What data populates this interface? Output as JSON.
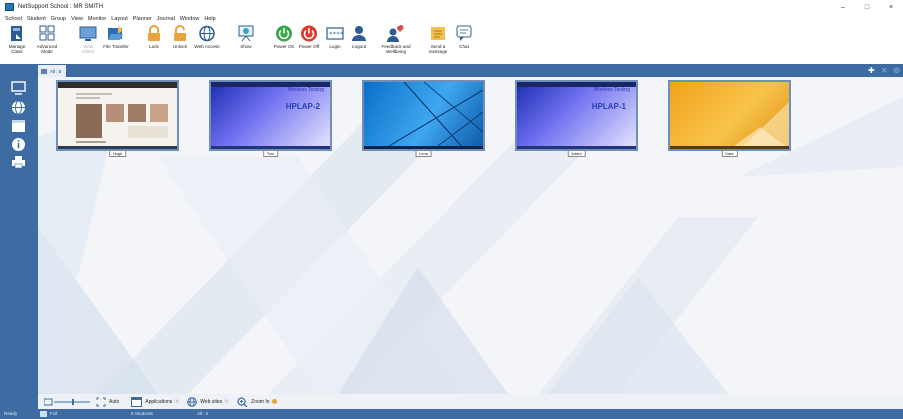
{
  "window": {
    "title": "NetSupport School : MR SMITH",
    "controls": {
      "minimize": "–",
      "maximize": "□",
      "close": "×"
    }
  },
  "menu": [
    "School",
    "Student",
    "Group",
    "View",
    "Monitor",
    "Layout",
    "Planner",
    "Journal",
    "Window",
    "Help"
  ],
  "toolbar": [
    {
      "label": "Manage\nClass",
      "icon": "manage-class-icon",
      "enabled": true
    },
    {
      "label": "Advanced\nMode",
      "icon": "advanced-mode-icon",
      "enabled": true
    },
    {
      "label": "View\nClient",
      "icon": "view-client-icon",
      "enabled": false
    },
    {
      "label": "File Transfer",
      "icon": "file-transfer-icon",
      "enabled": true
    },
    {
      "label": "Lock",
      "icon": "lock-icon",
      "enabled": true
    },
    {
      "label": "Unlock",
      "icon": "unlock-icon",
      "enabled": true
    },
    {
      "label": "Web Access",
      "icon": "web-access-icon",
      "enabled": true
    },
    {
      "label": "Show",
      "icon": "show-icon",
      "enabled": true
    },
    {
      "label": "Power On",
      "icon": "power-on-icon",
      "enabled": true
    },
    {
      "label": "Power Off",
      "icon": "power-off-icon",
      "enabled": true
    },
    {
      "label": "Login",
      "icon": "login-icon",
      "enabled": true
    },
    {
      "label": "Logout",
      "icon": "logout-icon",
      "enabled": true
    },
    {
      "label": "Feedback and\nWellbeing",
      "icon": "feedback-icon",
      "enabled": true
    },
    {
      "label": "Send a\nmessage",
      "icon": "send-message-icon",
      "enabled": true
    },
    {
      "label": "Chat",
      "icon": "chat-icon",
      "enabled": true
    }
  ],
  "tab": {
    "label": "All : 5"
  },
  "students": [
    {
      "name": "Hugh",
      "screen": "web"
    },
    {
      "name": "Tom",
      "screen": "Wireless Testing HPLAP-2"
    },
    {
      "name": "Lena",
      "screen": "desktop-blue"
    },
    {
      "name": "Adam",
      "screen": "Wireless Testing HPLAP-1"
    },
    {
      "name": "Kate",
      "screen": "desktop-orange"
    }
  ],
  "screens": {
    "tom": {
      "heading": "Wireless Testing",
      "host": "HPLAP-2"
    },
    "adam": {
      "heading": "Wireless Testing",
      "host": "HPLAP-1"
    }
  },
  "viewbar": {
    "auto": "Auto",
    "applications": "Applications",
    "websites": "Web sites",
    "zoom": "Zoom In"
  },
  "status": {
    "ready": "Ready",
    "mode": "Full",
    "students": "5 Students",
    "group": "All : 5"
  },
  "colors": {
    "accent": "#3d6ca3",
    "power_on": "#3aa64a",
    "power_off": "#d93b2b",
    "lock": "#e8a33a",
    "workspace": "#f3f5f9"
  }
}
